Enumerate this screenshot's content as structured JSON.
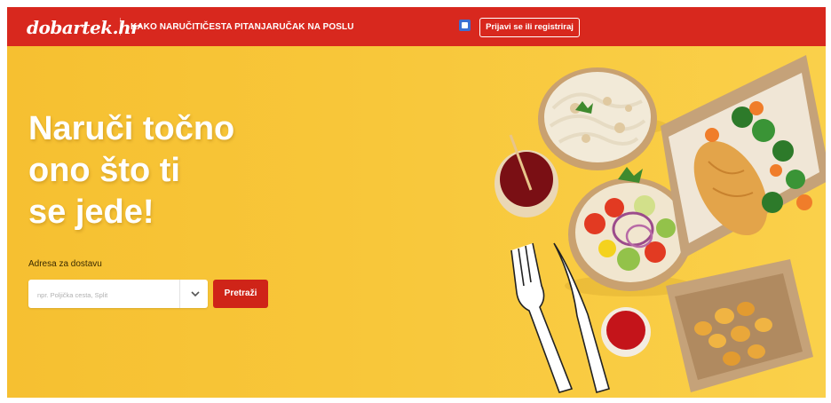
{
  "header": {
    "logo_text": "dobartek.hr",
    "nav": [
      {
        "label": "KAKO NARUČITI"
      },
      {
        "label": "ČESTA PITANJA"
      },
      {
        "label": "RUČAK NA POSLU"
      }
    ],
    "language_icon": "language-flag-icon",
    "login_label": "Prijavi se ili registriraj"
  },
  "hero": {
    "headline_lines": [
      "Naruči točno",
      "ono što ti",
      "se jede!"
    ],
    "address_label": "Adresa za dostavu",
    "address_placeholder": "npr. Poljička cesta, Split",
    "dropdown_icon": "chevron-down-icon",
    "search_label": "Pretraži"
  },
  "colors": {
    "header_bg": "#d8281e",
    "hero_bg": "#f7c233",
    "button_bg": "#cf2418",
    "text_light": "#ffffff"
  }
}
